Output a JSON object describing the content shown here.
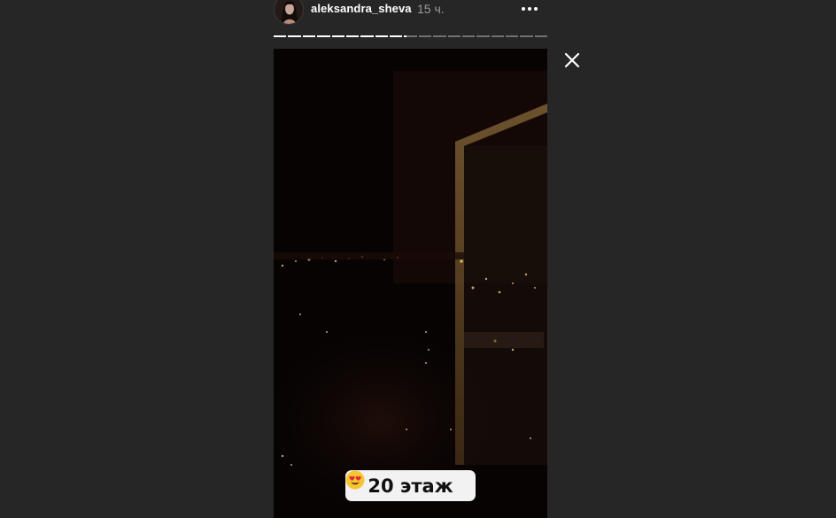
{
  "story": {
    "username": "aleksandra_sheva",
    "time_ago": "15 ч.",
    "progress": {
      "total_segments": 19,
      "completed_segments": 9,
      "current_segment_fraction": 0.2
    },
    "sticker_text": "20 этаж",
    "sticker_emoji": "heart-eyes-emoji"
  },
  "icons": {
    "more": "more-options-icon",
    "close": "close-icon"
  },
  "colors": {
    "background": "#262626",
    "sticker_background": "#f2f2f2",
    "username": "#ffffff",
    "time": "#9a9a9a"
  }
}
